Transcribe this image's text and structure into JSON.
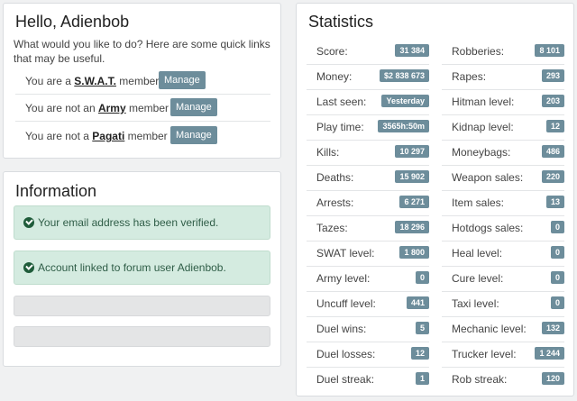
{
  "hello": {
    "greeting_prefix": "Hello, ",
    "username": "Adienbob",
    "intro": "What would you like to do? Here are some quick links that may be useful.",
    "memberships": [
      {
        "prefix": "You are a ",
        "group": "S.W.A.T.",
        "suffix": " member",
        "button": "Manage"
      },
      {
        "prefix": "You are not an ",
        "group": "Army",
        "suffix": " member",
        "button": "Manage"
      },
      {
        "prefix": "You are not a ",
        "group": "Pagati",
        "suffix": " member",
        "button": "Manage"
      }
    ]
  },
  "information": {
    "title": "Information",
    "alerts": [
      "Your email address has been verified.",
      "Account linked to forum user Adienbob."
    ]
  },
  "statistics": {
    "title": "Statistics",
    "left": [
      {
        "label": "Score:",
        "value": "31 384"
      },
      {
        "label": "Money:",
        "value": "$2 838 673"
      },
      {
        "label": "Last seen:",
        "value": "Yesterday"
      },
      {
        "label": "Play time:",
        "value": "3565h:50m"
      },
      {
        "label": "Kills:",
        "value": "10 297"
      },
      {
        "label": "Deaths:",
        "value": "15 902"
      },
      {
        "label": "Arrests:",
        "value": "6 271"
      },
      {
        "label": "Tazes:",
        "value": "18 296"
      },
      {
        "label": "SWAT level:",
        "value": "1 800"
      },
      {
        "label": "Army level:",
        "value": "0"
      },
      {
        "label": "Uncuff level:",
        "value": "441"
      },
      {
        "label": "Duel wins:",
        "value": "5"
      },
      {
        "label": "Duel losses:",
        "value": "12"
      },
      {
        "label": "Duel streak:",
        "value": "1"
      }
    ],
    "right": [
      {
        "label": "Robberies:",
        "value": "8 101"
      },
      {
        "label": "Rapes:",
        "value": "293"
      },
      {
        "label": "Hitman level:",
        "value": "203"
      },
      {
        "label": "Kidnap level:",
        "value": "12"
      },
      {
        "label": "Moneybags:",
        "value": "486"
      },
      {
        "label": "Weapon sales:",
        "value": "220"
      },
      {
        "label": "Item sales:",
        "value": "13"
      },
      {
        "label": "Hotdogs sales:",
        "value": "0"
      },
      {
        "label": "Heal level:",
        "value": "0"
      },
      {
        "label": "Cure level:",
        "value": "0"
      },
      {
        "label": "Taxi level:",
        "value": "0"
      },
      {
        "label": "Mechanic level:",
        "value": "132"
      },
      {
        "label": "Trucker level:",
        "value": "1 244"
      },
      {
        "label": "Rob streak:",
        "value": "120"
      }
    ]
  },
  "colors": {
    "badge": "#6d8d9b",
    "alert_bg": "#d4ebe0",
    "check_icon": "#1f5c3a"
  }
}
